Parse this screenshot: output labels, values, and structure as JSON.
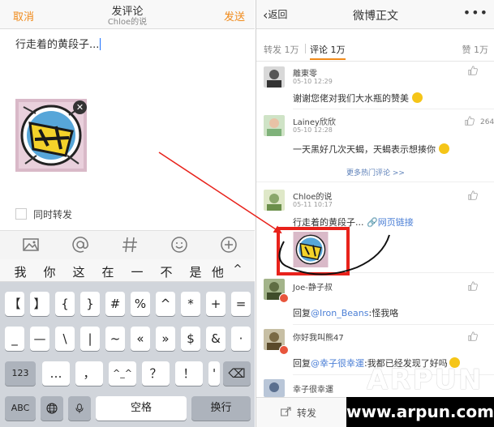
{
  "left": {
    "header": {
      "cancel": "取消",
      "title": "发评论",
      "subtitle": "Chloe的说",
      "send": "发送"
    },
    "compose_text": "行走着的黄段子...",
    "attachment_image": "zan-sticker",
    "repost_option": "同时转发",
    "toolbar_icons": [
      "image-icon",
      "at-icon",
      "hashtag-icon",
      "emoji-icon",
      "plus-icon"
    ],
    "suggestions": [
      "我",
      "你",
      "这",
      "在",
      "一",
      "不",
      "是",
      "他"
    ],
    "keyboard": {
      "row1": [
        "【",
        "】",
        "{",
        "}",
        "#",
        "%",
        "^",
        "*",
        "+",
        "="
      ],
      "row2": [
        "_",
        "—",
        "\\",
        "|",
        "~",
        "«",
        "»",
        "$",
        "&",
        "·"
      ],
      "row3": [
        "123",
        "…",
        "，",
        "^_^",
        "？",
        "！",
        "'",
        "⌫"
      ],
      "row4": [
        "ABC",
        "🌐",
        "🎤",
        "空格",
        "换行"
      ]
    }
  },
  "right": {
    "header": {
      "back": "返回",
      "title": "微博正文",
      "more": "•••"
    },
    "tabs": {
      "repost": "转发 1万",
      "comments": "评论 1万",
      "likes": "赞 1万"
    },
    "comments": [
      {
        "name": "離東零",
        "time": "05-10 12:29",
        "text": "谢谢您佬对我们大水瓶的赞美",
        "likes": ""
      },
      {
        "name": "Lainey欣欣",
        "time": "05-10 12:28",
        "text": "一天黑好几次天蝎，天蝎表示想揍你",
        "likes": "264"
      },
      {
        "name": "Chloe的说",
        "time": "05-11 10:17",
        "text": "行走着的黄段子...",
        "link": "网页链接",
        "likes": ""
      },
      {
        "name": "Joe-静子叔",
        "time": "",
        "text": "回复",
        "mention": "@Iron_Beans",
        "rest": ":怪我咯",
        "likes": ""
      },
      {
        "name": "你好我叫熊47",
        "time": "",
        "text": "回复",
        "mention": "@幸子很幸運",
        "rest": ":我都已经发现了好吗",
        "likes": ""
      },
      {
        "name": "幸子很幸運",
        "time": "",
        "text": "",
        "likes": ""
      }
    ],
    "more_hot": "更多热门评论 >>",
    "bottom_bar": {
      "repost": "转发"
    }
  },
  "watermark": {
    "big": "ARPUN",
    "url": "www.arpun.com"
  },
  "colors": {
    "accent": "#f08a1a",
    "highlight_box": "#e8221b",
    "arrow": "#e8221b",
    "link": "#4b7fd6"
  }
}
